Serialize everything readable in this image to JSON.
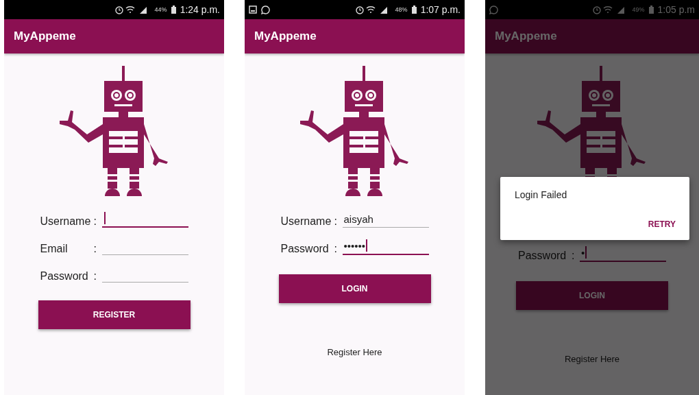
{
  "screens": [
    {
      "status": {
        "battery": "44%",
        "time": "1:24 p.m."
      },
      "title": "MyAppeme",
      "fields": [
        {
          "label": "Username",
          "colon": ":",
          "focused": true
        },
        {
          "label": "Email",
          "colon": ":",
          "focused": false
        },
        {
          "label": "Password",
          "colon": ":",
          "focused": false
        }
      ],
      "button": "REGISTER"
    },
    {
      "status": {
        "notifications": [
          {
            "kind": "image"
          },
          {
            "kind": "chat"
          }
        ],
        "battery": "48%",
        "time": "1:07 p.m."
      },
      "title": "MyAppeme",
      "fields": [
        {
          "label": "Username",
          "colon": ":",
          "value": "aisyah",
          "focused": false
        },
        {
          "label": "Password",
          "colon": ":",
          "value": "••••••",
          "focused": true
        }
      ],
      "button": "LOGIN",
      "link": "Register Here"
    },
    {
      "status": {
        "notifications": [
          {
            "kind": "chat"
          }
        ],
        "battery": "49%",
        "time": "1:05 p.m"
      },
      "title": "MyAppeme",
      "fields": [
        {
          "label": "Password",
          "colon": ":",
          "value": "•",
          "focused": true
        }
      ],
      "button": "LOGIN",
      "link": "Register Here",
      "dialog": {
        "message": "Login Failed",
        "action": "RETRY"
      }
    }
  ]
}
